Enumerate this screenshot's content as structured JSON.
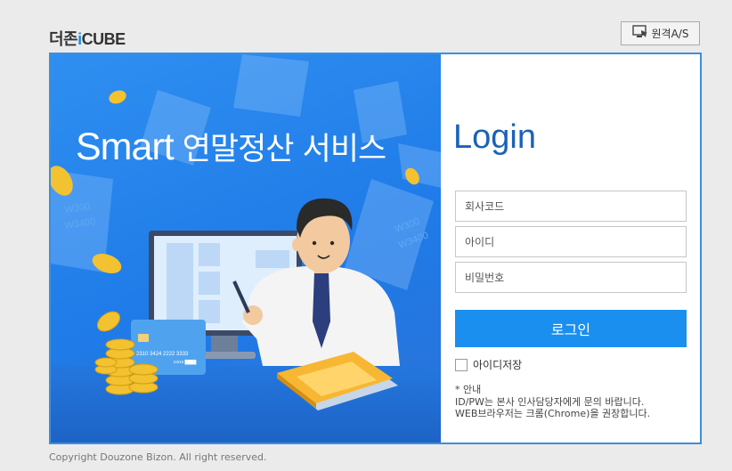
{
  "header": {
    "logo_prefix": "더존",
    "logo_i": "i",
    "logo_suffix": "CUBE",
    "remote_button_label": "원격A/S",
    "remote_icon": "monitor-cursor-icon"
  },
  "hero": {
    "title_en": "Smart",
    "title_kr": "연말정산 서비스",
    "card_number": "2310 3424 2222 3333",
    "card_expiry": "04/15 ████",
    "receipt_amounts": [
      "W300",
      "W3400",
      "W300",
      "W3400"
    ]
  },
  "login": {
    "title": "Login",
    "company_code_placeholder": "회사코드",
    "user_id_placeholder": "아이디",
    "password_placeholder": "비밀번호",
    "submit_label": "로그인",
    "save_id_label": "아이디저장",
    "notice_heading": "* 안내",
    "notice_line1": "ID/PW는 본사 인사담당자에게 문의 바랍니다.",
    "notice_line2": "WEB브라우저는 크롬(Chrome)을 권장합니다."
  },
  "footer": {
    "copyright": "Copyright Douzone Bizon. All right reserved."
  },
  "colors": {
    "accent": "#1a8ff0",
    "title_blue": "#1a62b8",
    "frame_border": "#3d8fd8",
    "hero_blue": "#2f8ff0"
  }
}
